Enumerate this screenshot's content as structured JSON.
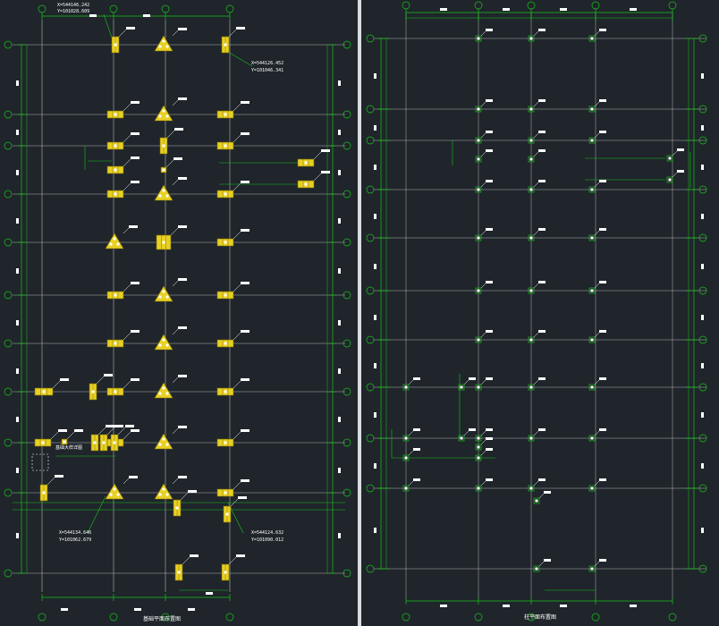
{
  "left": {
    "title": "基础平面布置图",
    "coords": [
      {
        "id": "c-top",
        "x_label": "X=544146.242",
        "y_label": "Y=101028.609"
      },
      {
        "id": "c-right-top",
        "x_label": "X=544126.452",
        "y_label": "Y=101046.341"
      },
      {
        "id": "c-left-bottom",
        "x_label": "X=544134.646",
        "y_label": "Y=101062.679"
      },
      {
        "id": "c-right-bottom",
        "x_label": "X=544124.632",
        "y_label": "Y=101090.012"
      }
    ],
    "mid_label": "基础大样详图"
  },
  "right": {
    "title": "柱平面布置图",
    "tags": [
      "KZ1",
      "KZ2",
      "KZ3",
      "KZ4"
    ]
  },
  "colors": {
    "background": "#1f252b",
    "dimension": "#19c419",
    "axis_line": "#b5b5b5",
    "footing": "#e8d024",
    "column_mark": "#ffffff",
    "divider": "#d9dde0"
  }
}
